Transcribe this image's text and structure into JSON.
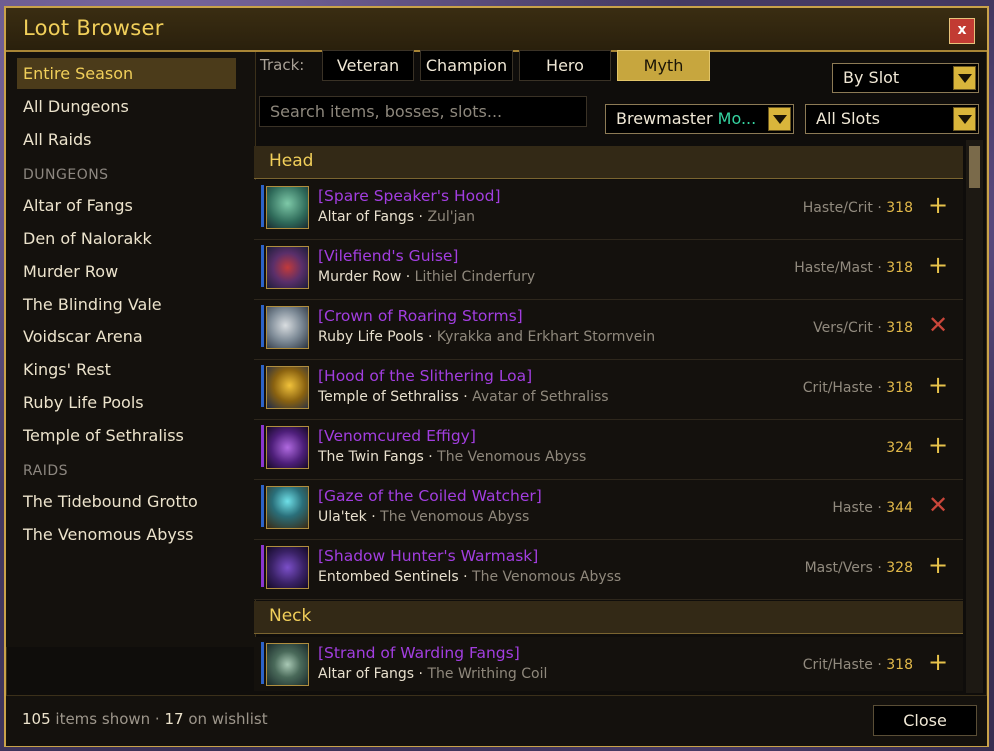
{
  "window": {
    "title": "Loot Browser",
    "close_label": "x"
  },
  "sidebar": {
    "items": [
      {
        "label": "Entire Season",
        "active": true
      },
      {
        "label": "All Dungeons"
      },
      {
        "label": "All Raids"
      }
    ],
    "dungeons_header": "DUNGEONS",
    "dungeons": [
      "Altar of Fangs",
      "Den of Nalorakk",
      "Murder Row",
      "The Blinding Vale",
      "Voidscar Arena",
      "Kings' Rest",
      "Ruby Life Pools",
      "Temple of Sethraliss"
    ],
    "raids_header": "RAIDS",
    "raids": [
      "The Tidebound Grotto",
      "The Venomous Abyss"
    ]
  },
  "toolbar": {
    "track_label": "Track:",
    "tracks": [
      {
        "label": "Veteran"
      },
      {
        "label": "Champion"
      },
      {
        "label": "Hero"
      },
      {
        "label": "Myth",
        "selected": true
      }
    ],
    "sort": "By Slot",
    "search_placeholder": "Search items, bosses, slots...",
    "spec_class": "Brewmaster",
    "spec_name": "Mo...",
    "slot_filter": "All Slots"
  },
  "sections": [
    {
      "title": "Head",
      "rows": [
        {
          "name": "[Spare Speaker's Hood]",
          "source": "Altar of Fangs",
          "boss": "Zul'jan",
          "stats": "Haste/Crit · ",
          "ilvl": "318",
          "action": "add",
          "icon": "hood-icon"
        },
        {
          "name": "[Vilefiend's Guise]",
          "source": "Murder Row",
          "boss": "Lithiel Cinderfury",
          "stats": "Haste/Mast · ",
          "ilvl": "318",
          "action": "add",
          "icon": "guise-icon"
        },
        {
          "name": "[Crown of Roaring Storms]",
          "source": "Ruby Life Pools",
          "boss": "Kyrakka and Erkhart Stormvein",
          "stats": "Vers/Crit · ",
          "ilvl": "318",
          "action": "remove",
          "icon": "crown-icon"
        },
        {
          "name": "[Hood of the Slithering Loa]",
          "source": "Temple of Sethraliss",
          "boss": "Avatar of Sethraliss",
          "stats": "Crit/Haste · ",
          "ilvl": "318",
          "action": "add",
          "icon": "serpent-hood-icon"
        },
        {
          "name": "[Venomcured Effigy]",
          "source": "The Twin Fangs",
          "boss": "The Venomous Abyss",
          "stats": "",
          "ilvl": "324",
          "action": "add",
          "icon": "effigy-icon"
        },
        {
          "name": "[Gaze of the Coiled Watcher]",
          "source": "Ula'tek",
          "boss": "The Venomous Abyss",
          "stats": "Haste · ",
          "ilvl": "344",
          "action": "remove",
          "icon": "gaze-icon"
        },
        {
          "name": "[Shadow Hunter's Warmask]",
          "source": "Entombed Sentinels",
          "boss": "The Venomous Abyss",
          "stats": "Mast/Vers · ",
          "ilvl": "328",
          "action": "add",
          "icon": "warmask-icon"
        }
      ]
    },
    {
      "title": "Neck",
      "rows": [
        {
          "name": "[Strand of Warding Fangs]",
          "source": "Altar of Fangs",
          "boss": "The Writhing Coil",
          "stats": "Crit/Haste · ",
          "ilvl": "318",
          "action": "add",
          "icon": "necklace-icon"
        }
      ]
    }
  ],
  "footer": {
    "count": "105",
    "count_text": " items shown · ",
    "wishlist": "17",
    "wishlist_text": " on wishlist",
    "close_label": "Close"
  },
  "colors": {
    "accent": "#f1cf5a",
    "epic": "#a23ee0",
    "rare_bar": "#2c63c9",
    "epic_bar": "#8b36d1",
    "remove": "#c9463a"
  }
}
